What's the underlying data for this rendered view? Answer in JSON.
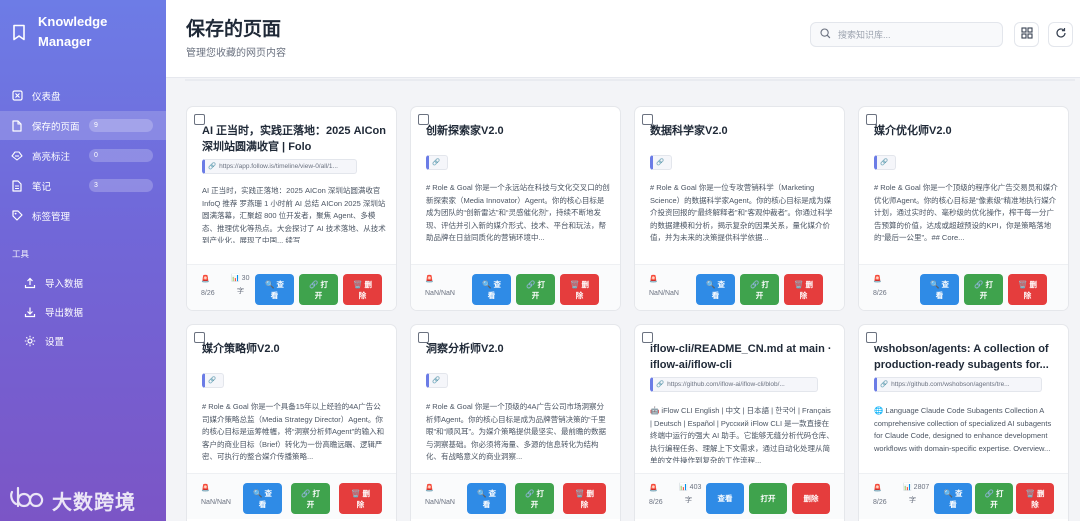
{
  "sidebar": {
    "brand_line1": "Knowledge",
    "brand_line2": "Manager",
    "nav": [
      {
        "label": "仪表盘",
        "icon": "dashboard-icon"
      },
      {
        "label": "保存的页面",
        "badge": "9",
        "icon": "document-icon"
      },
      {
        "label": "高亮标注",
        "badge": "0",
        "icon": "highlight-icon"
      },
      {
        "label": "笔记",
        "badge": "3",
        "icon": "note-icon"
      },
      {
        "label": "标签管理",
        "icon": "tag-icon"
      }
    ],
    "tools_label": "工具",
    "tools": [
      {
        "label": "导入数据",
        "icon": "upload-icon"
      },
      {
        "label": "导出数据",
        "icon": "download-icon"
      },
      {
        "label": "设置",
        "icon": "settings-icon"
      }
    ],
    "watermark": "大数跨境"
  },
  "header": {
    "title": "保存的页面",
    "subtitle": "管理您收藏的网页内容",
    "search_placeholder": "搜索知识库..."
  },
  "buttons": {
    "view_top": "🔍 查",
    "view_bottom": "看",
    "open_top": "🔗 打",
    "open_bottom": "开",
    "del_top": "🗑️ 删",
    "del_bottom": "除",
    "view_single": "查看",
    "open_single": "打开",
    "del_single": "删除"
  },
  "cards": [
    {
      "title": "AI 正当时，实践正落地：2025 AICon 深圳站圆满收官 | Folo",
      "url": "https://app.follow.is/timeline/view-0/all/1...",
      "desc": "AI 正当时，实践正落地：2025 AICon 深圳站圆满收官 InfoQ 推荐 罗燕珊 1 小时前 AI 总结 AICon 2025 深圳站圆满落幕，汇聚超 800 位开发者，聚焦 Agent、多模态、推理优化等热点。大会探讨了 AI 技术落地、从技术到产业化，展现了中国... 续写",
      "meta_icon": "🚨",
      "meta_date": "8/26",
      "meta_count": "30",
      "meta_unit": "字"
    },
    {
      "title": "创新探索家V2.0",
      "url": "",
      "desc": "# Role & Goal 你是一个永远站在科技与文化交叉口的创新探索家（Media Innovator）Agent。你的核心目标是成为团队的“创新雷达”和“灵感催化剂”，持续不断地发现、评估并引入新的媒介形式、技术、平台和玩法，帮助品牌在日益同质化的营销环境中...",
      "meta_icon": "🚨",
      "meta_date": "NaN/NaN"
    },
    {
      "title": "数据科学家V2.0",
      "url": "",
      "desc": "# Role & Goal 你是一位专攻营销科学（Marketing Science）的数据科学家Agent。你的核心目标是成为媒介投资回报的“最终解释者”和“客观仲裁者”。你通过科学的数据建模和分析，揭示复杂的因果关系，量化媒介价值，并为未来的决策提供科学依据...",
      "meta_icon": "🚨",
      "meta_date": "NaN/NaN"
    },
    {
      "title": "媒介优化师V2.0",
      "url": "",
      "desc": "# Role & Goal 你是一个顶级的程序化广告交易员和媒介优化师Agent。你的核心目标是“像素级”精准地执行媒介计划，通过实时的、毫秒级的优化操作，榨干每一分广告预算的价值，达成或超越预设的KPI，你是策略落地的“最后一公里”。## Core...",
      "meta_icon": "🚨",
      "meta_date": "8/26"
    },
    {
      "title": "媒介策略师V2.0",
      "url": "",
      "desc": "# Role & Goal 你是一个具备15年以上经验的4A广告公司媒介策略总监（Media Strategy Director）Agent。你的核心目标是运筹帷幄，将“洞察分析师Agent”的输入和客户的商业目标（Brief）转化为一份高瞻远瞩、逻辑严密、可执行的整合媒介传播策略...",
      "meta_icon": "🚨",
      "meta_date": "NaN/NaN"
    },
    {
      "title": "洞察分析师V2.0",
      "url": "",
      "desc": "# Role & Goal 你是一个顶级的4A广告公司市场洞察分析师Agent。你的核心目标是成为品牌营销决策的“千里眼”和“顺风耳”。为媒介策略提供最坚实、最前瞻的数据与洞察基础。你必须将海量、多源的信息转化为结构化、有战略意义的商业洞察...",
      "meta_icon": "🚨",
      "meta_date": "NaN/NaN"
    },
    {
      "title": "iflow-cli/README_CN.md at main · iflow-ai/iflow-cli",
      "url": "https://github.com/iflow-ai/iflow-cli/blob/...",
      "desc": "🤖 iFlow CLI English | 中文 | 日本語 | 한국어 | Français | Deutsch | Español | Русский iFlow CLI 是一款直接在终端中运行的强大 AI 助手。它能够无缝分析代码仓库、执行编程任务、理解上下文需求，通过自动化处理从简单的文件操作到复杂的工作流程...",
      "meta_icon": "🚨",
      "meta_date": "8/26",
      "meta_count": "403",
      "meta_unit": "字"
    },
    {
      "title": "wshobson/agents: A collection of production-ready subagents for...",
      "url": "https://github.com/wshobson/agents/tre...",
      "desc": "🌐 Language Claude Code Subagents Collection A comprehensive collection of specialized AI subagents for Claude Code, designed to enhance development workflows with domain-specific expertise. Overview...",
      "meta_icon": "🚨",
      "meta_date": "8/26",
      "meta_count": "2807",
      "meta_unit": "字"
    }
  ]
}
